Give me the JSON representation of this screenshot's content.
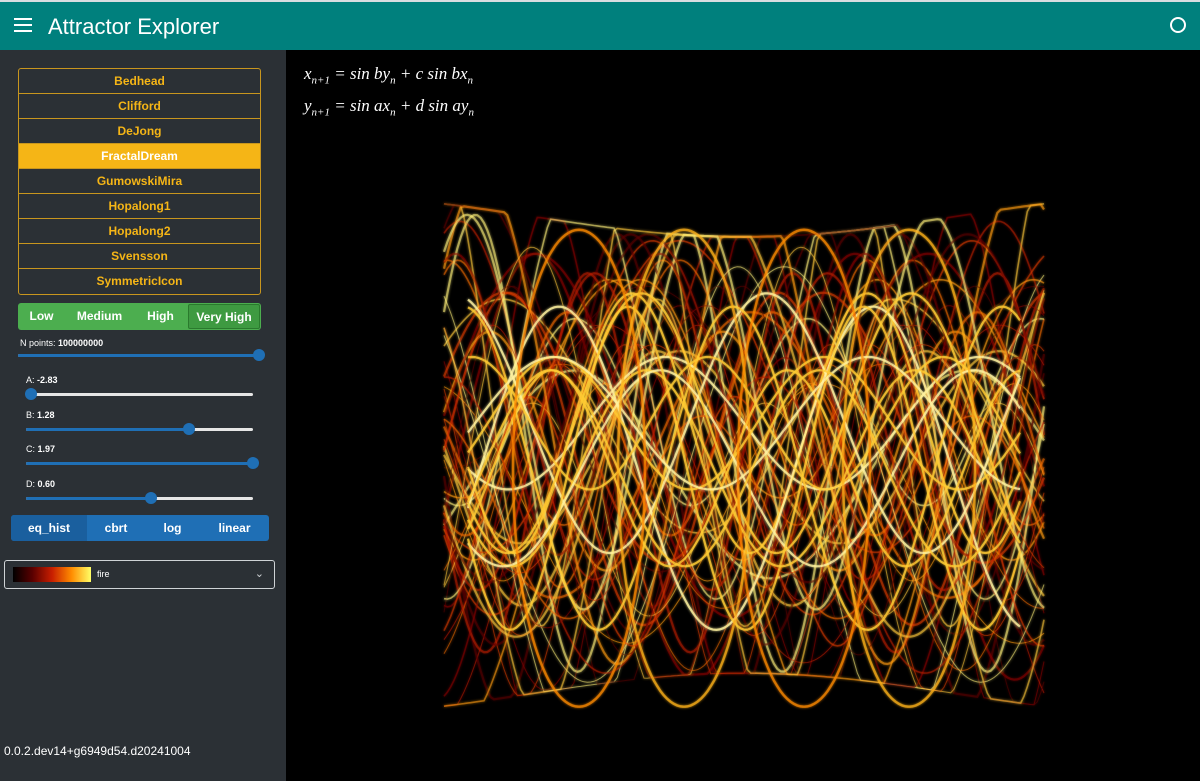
{
  "app": {
    "title": "Attractor Explorer"
  },
  "attractors": [
    "Bedhead",
    "Clifford",
    "DeJong",
    "FractalDream",
    "GumowskiMira",
    "Hopalong1",
    "Hopalong2",
    "Svensson",
    "SymmetricIcon"
  ],
  "selected_attractor": "FractalDream",
  "quality": {
    "options": [
      "Low",
      "Medium",
      "High",
      "Very High"
    ],
    "selected": "Very High"
  },
  "n_points": {
    "label": "N points: ",
    "value": "100000000",
    "fraction": 1.0
  },
  "params": [
    {
      "label": "A: ",
      "value": "-2.83",
      "fraction": 0.02
    },
    {
      "label": "B: ",
      "value": "1.28",
      "fraction": 0.72
    },
    {
      "label": "C: ",
      "value": "1.97",
      "fraction": 1.0
    },
    {
      "label": "D: ",
      "value": "0.60",
      "fraction": 0.55
    }
  ],
  "normalization": {
    "options": [
      "eq_hist",
      "cbrt",
      "log",
      "linear"
    ],
    "selected": "eq_hist"
  },
  "colormap": {
    "name": "fire"
  },
  "version": "0.0.2.dev14+g6949d54.d20241004",
  "formula": {
    "line1": {
      "lhs": "x",
      "lhs_sub": "n+1",
      "eq": " = sin ",
      "t1": "by",
      "t1_sub": "n",
      "mid": " + c sin ",
      "t2": "bx",
      "t2_sub": "n"
    },
    "line2": {
      "lhs": "y",
      "lhs_sub": "n+1",
      "eq": " = sin ",
      "t1": "ax",
      "t1_sub": "n",
      "mid": " + d sin ",
      "t2": "ay",
      "t2_sub": "n"
    }
  },
  "colors": {
    "header": "#00807d",
    "sidebar": "#2b3035",
    "accent_gold": "#f5b516",
    "quality_green": "#4cae4f",
    "blue": "#1f6fb5"
  }
}
